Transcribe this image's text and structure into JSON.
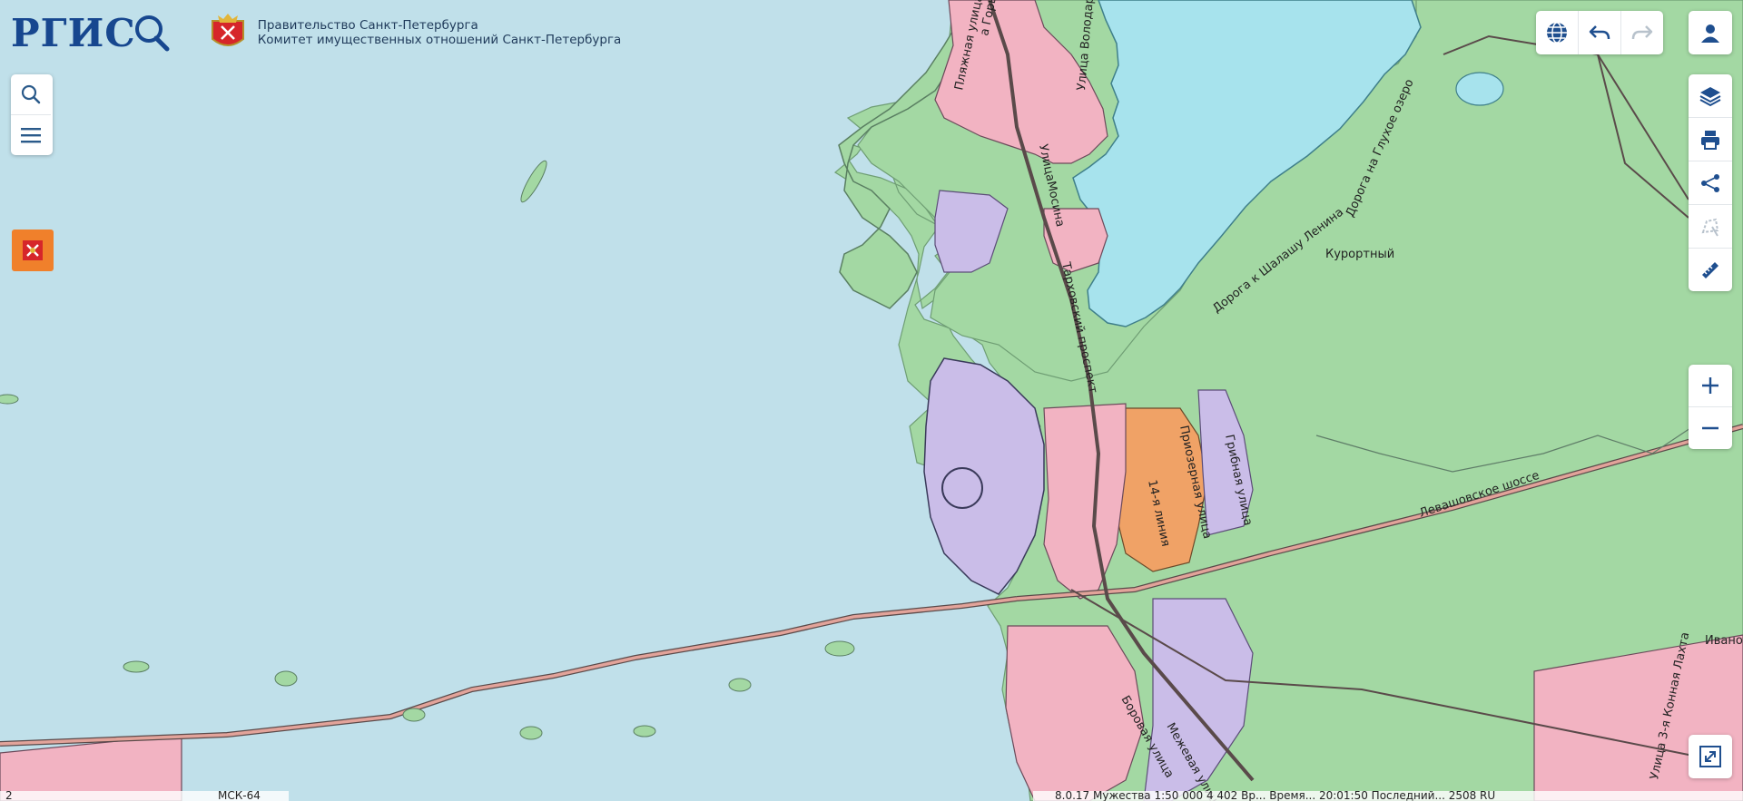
{
  "header": {
    "logo_text": "РГИС",
    "gov_line1": "Правительство Санкт-Петербурга",
    "gov_line2": "Комитет имущественных отношений Санкт-Петербурга"
  },
  "map_labels": {
    "plyazhnaya": "Пляжная улица",
    "gorkogo": "а Горького",
    "volodarskogo": "Улица Володарского",
    "mosina": "УлицаМосина",
    "tarhovsky": "Тарховский проспект",
    "doroga_lenina": "Дорога к Шалашу Ленина",
    "doroga_gluhoe": "Дорога на Глухое озеро",
    "kurortny": "Курортный",
    "priozernaya": "Приозерная улица",
    "gribnaya": "Грибная улица",
    "liniya14": "14-я линия",
    "levashovskoe": "Левашовское шоссе",
    "borovaya": "Боровая улица",
    "mezhevaya": "Межевая улица",
    "ivan": "Ивано",
    "komandarm": "Улица 3-я Конная Лахта"
  },
  "status": {
    "left_text": "2",
    "crs": "МСК-64",
    "right_text": "8.0.17   Мужества   1:50 000   4 402   Вр...   Время...   20:01:50   Последний...   2508   RU"
  },
  "colors": {
    "water": "#c0e0ea",
    "lake": "#a7e3ed",
    "forest": "#a3d8a3",
    "residential": "#f2b3c2",
    "industrial": "#cabde8",
    "road": "#c47b6c",
    "accent": "#17478f",
    "orange": "#f0802b"
  }
}
